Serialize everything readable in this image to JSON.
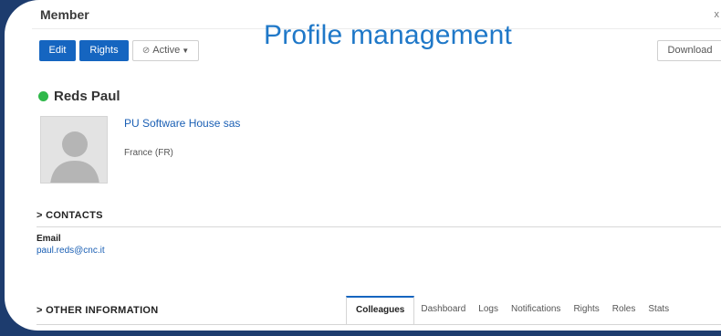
{
  "overlay": {
    "title": "Profile management"
  },
  "header": {
    "title": "Member",
    "close": "x"
  },
  "toolbar": {
    "edit_label": "Edit",
    "rights_label": "Rights",
    "status_label": "Active",
    "download_label": "Download"
  },
  "profile": {
    "name": "Reds Paul",
    "status_color": "#2fb84a",
    "company": "PU Software House sas",
    "country": "France (FR)"
  },
  "contacts": {
    "section_title": "> CONTACTS",
    "email_label": "Email",
    "email_value": "paul.reds@cnc.it"
  },
  "other": {
    "section_title": "> OTHER INFORMATION",
    "tabs": [
      {
        "label": "Colleagues",
        "active": true
      },
      {
        "label": "Dashboard",
        "active": false
      },
      {
        "label": "Logs",
        "active": false
      },
      {
        "label": "Notifications",
        "active": false
      },
      {
        "label": "Rights",
        "active": false
      },
      {
        "label": "Roles",
        "active": false
      },
      {
        "label": "Stats",
        "active": false
      }
    ]
  },
  "colors": {
    "accent": "#1565c0",
    "frame": "#1d3c6e",
    "link": "#1a5fb4",
    "title_overlay": "#1f78c8"
  }
}
